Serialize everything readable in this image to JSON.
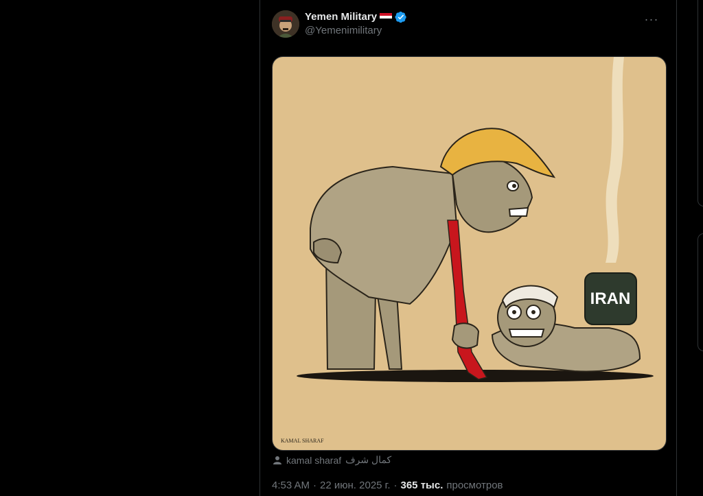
{
  "post": {
    "author": {
      "display_name": "Yemen Military",
      "handle": "@Yemenimilitary",
      "verified": true,
      "flag": "yemen-flag"
    },
    "more_icon": "more-horizontal-icon",
    "image": {
      "caption_text": "IRAN",
      "signature": "KAMAL SHARAF"
    },
    "credit": {
      "icon": "person-icon",
      "name": "kamal  sharaf",
      "name_arabic": "كمال شرف"
    },
    "meta": {
      "time": "4:53 AM",
      "sep1": "·",
      "date": "22 июн. 2025 г.",
      "sep2": "·",
      "views_count": "365 тыс.",
      "views_label": "просмотров"
    }
  },
  "colors": {
    "background": "#000000",
    "border": "#2f3336",
    "text_primary": "#e7e9ea",
    "text_secondary": "#71767b",
    "verified_blue": "#1d9bf0",
    "cartoon_background": "#dfc08c"
  }
}
